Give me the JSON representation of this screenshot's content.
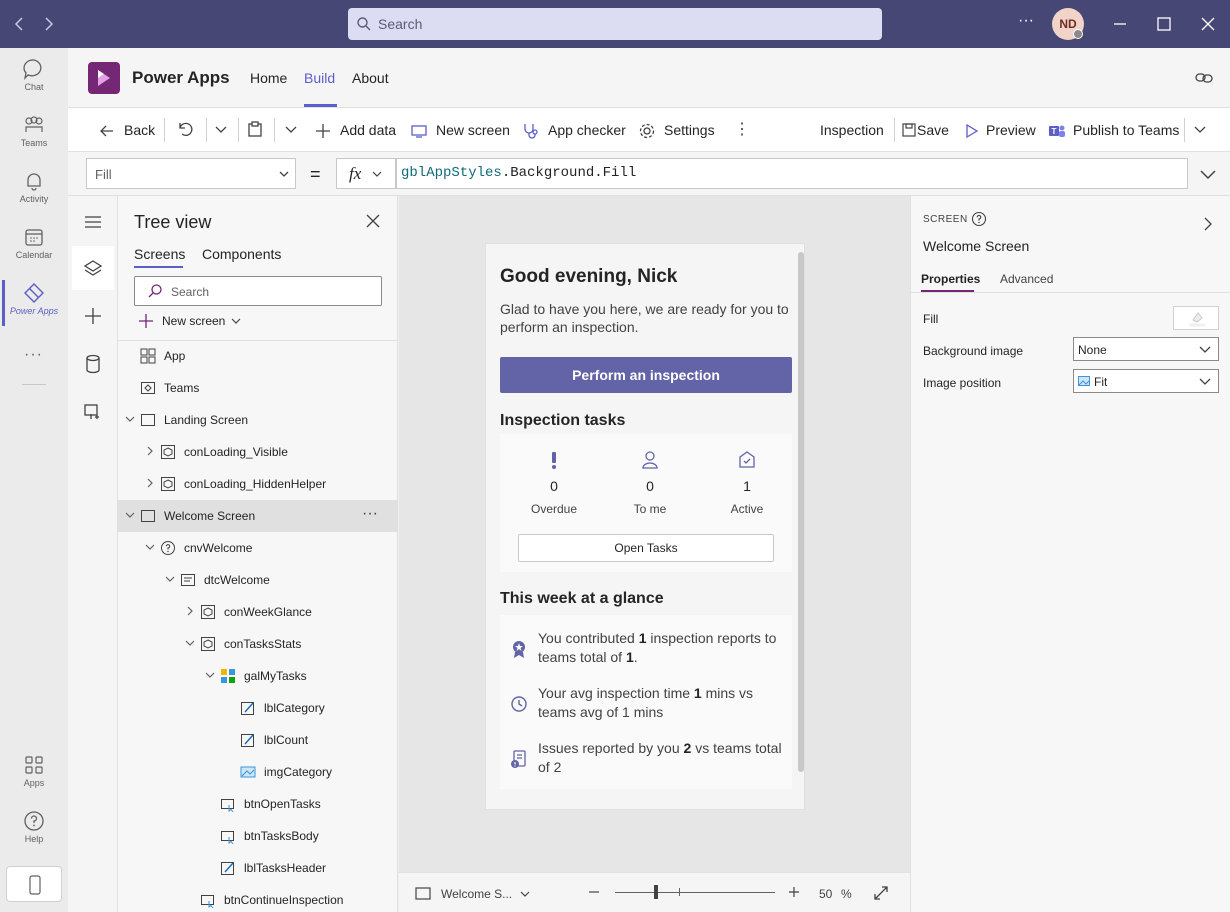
{
  "titlebar": {
    "search_placeholder": "Search",
    "avatar_initials": "ND",
    "more": "···"
  },
  "rail": [
    {
      "label": "Chat",
      "icon": "chat-icon"
    },
    {
      "label": "Teams",
      "icon": "teams-icon"
    },
    {
      "label": "Activity",
      "icon": "bell-icon"
    },
    {
      "label": "Calendar",
      "icon": "calendar-icon"
    },
    {
      "label": "Power Apps",
      "icon": "power-apps-icon",
      "active": true
    },
    {
      "label": "Apps",
      "icon": "apps-icon"
    },
    {
      "label": "Help",
      "icon": "help-icon"
    }
  ],
  "app_header": {
    "app_name": "Power Apps",
    "tabs": [
      "Home",
      "Build",
      "About"
    ],
    "active_tab": "Build"
  },
  "commandbar": {
    "back": "Back",
    "add_data": "Add data",
    "new_screen": "New screen",
    "app_checker": "App checker",
    "settings": "Settings",
    "inspection": "Inspection",
    "save": "Save",
    "preview": "Preview",
    "publish": "Publish to Teams"
  },
  "formulabar": {
    "property": "Fill",
    "equals": "=",
    "fx": "fx",
    "formula_var": "gblAppStyles",
    "formula_rest": ".Background.Fill"
  },
  "tree": {
    "title": "Tree view",
    "tabs": [
      "Screens",
      "Components"
    ],
    "search_placeholder": "Search",
    "new_screen": "New screen",
    "nodes": [
      {
        "label": "App",
        "icon": "app-icon",
        "depth": 0,
        "chev": ""
      },
      {
        "label": "Teams",
        "icon": "teams-node-icon",
        "depth": 0,
        "chev": ""
      },
      {
        "label": "Landing Screen",
        "icon": "screen-icon",
        "depth": 0,
        "chev": "down"
      },
      {
        "label": "conLoading_Visible",
        "icon": "container-icon",
        "depth": 1,
        "chev": "right"
      },
      {
        "label": "conLoading_HiddenHelper",
        "icon": "container-icon",
        "depth": 1,
        "chev": "right"
      },
      {
        "label": "Welcome Screen",
        "icon": "screen-icon",
        "depth": 0,
        "chev": "down",
        "selected": true
      },
      {
        "label": "cnvWelcome",
        "icon": "canvas-icon",
        "depth": 1,
        "chev": "down"
      },
      {
        "label": "dtcWelcome",
        "icon": "datacard-icon",
        "depth": 2,
        "chev": "down"
      },
      {
        "label": "conWeekGlance",
        "icon": "container-icon",
        "depth": 3,
        "chev": "right"
      },
      {
        "label": "conTasksStats",
        "icon": "container-icon",
        "depth": 3,
        "chev": "down"
      },
      {
        "label": "galMyTasks",
        "icon": "gallery-icon",
        "depth": 4,
        "chev": "down"
      },
      {
        "label": "lblCategory",
        "icon": "label-icon",
        "depth": 5,
        "chev": ""
      },
      {
        "label": "lblCount",
        "icon": "label-icon",
        "depth": 5,
        "chev": ""
      },
      {
        "label": "imgCategory",
        "icon": "image-icon",
        "depth": 5,
        "chev": ""
      },
      {
        "label": "btnOpenTasks",
        "icon": "button-icon",
        "depth": 4,
        "chev": ""
      },
      {
        "label": "btnTasksBody",
        "icon": "button-icon",
        "depth": 4,
        "chev": ""
      },
      {
        "label": "lblTasksHeader",
        "icon": "label-icon",
        "depth": 4,
        "chev": ""
      },
      {
        "label": "btnContinueInspection",
        "icon": "button-icon",
        "depth": 3,
        "chev": ""
      }
    ]
  },
  "phone": {
    "greeting": "Good evening, Nick",
    "subtext": "Glad to have you here, we are ready for you to perform an inspection.",
    "perform_button": "Perform an inspection",
    "tasks_header": "Inspection tasks",
    "stats": [
      {
        "count": "0",
        "label": "Overdue",
        "icon": "exclamation-icon"
      },
      {
        "count": "0",
        "label": "To me",
        "icon": "person-icon"
      },
      {
        "count": "1",
        "label": "Active",
        "icon": "active-task-icon"
      }
    ],
    "open_tasks": "Open Tasks",
    "glance_header": "This week at a glance",
    "glance": [
      {
        "icon": "ribbon-icon",
        "pre": "You contributed ",
        "b1": "1",
        "mid": " inspection reports to teams total of ",
        "b2": "1",
        "post": "."
      },
      {
        "icon": "clock-icon",
        "pre": "Your avg inspection time ",
        "b1": "1",
        "mid": " mins vs teams avg of 1 mins",
        "b2": "",
        "post": ""
      },
      {
        "icon": "issue-icon",
        "pre": "Issues reported by you ",
        "b1": "2",
        "mid": " vs teams total of 2",
        "b2": "",
        "post": ""
      }
    ]
  },
  "canvas_bottom": {
    "screen_name": "Welcome S...",
    "zoom_value": "50",
    "zoom_unit": "%"
  },
  "props": {
    "kind": "SCREEN",
    "name": "Welcome Screen",
    "tabs": [
      "Properties",
      "Advanced"
    ],
    "rows": {
      "fill_label": "Fill",
      "bg_image_label": "Background image",
      "bg_image_value": "None",
      "img_pos_label": "Image position",
      "img_pos_value": "Fit"
    }
  }
}
